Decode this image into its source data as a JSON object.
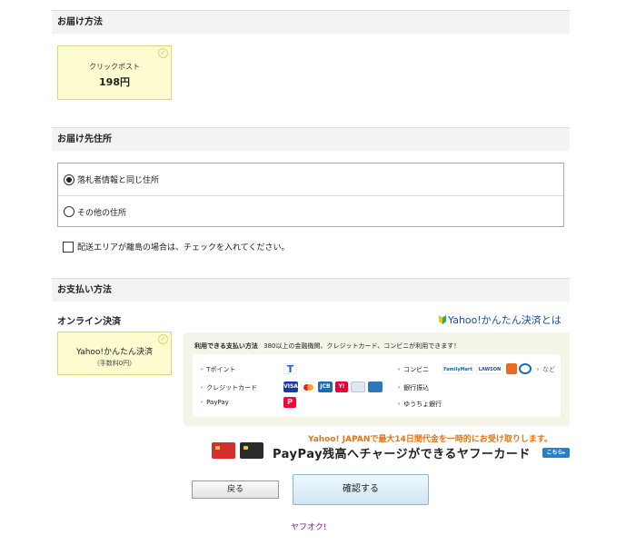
{
  "delivery_method": {
    "heading": "お届け方法",
    "options": [
      {
        "name": "クリックポスト",
        "price": "198円",
        "selected": true
      }
    ]
  },
  "delivery_address": {
    "heading": "お届け先住所",
    "options": [
      {
        "label": "落札者情報と同じ住所",
        "selected": true
      },
      {
        "label": "その他の住所",
        "selected": false
      }
    ],
    "island_checkbox_label": "配送エリアが離島の場合は、チェックを入れてください。",
    "island_checked": false
  },
  "payment": {
    "heading": "お支払い方法",
    "online_label": "オンライン決済",
    "about_link": "Yahoo!かんたん決済とは",
    "option": {
      "name": "Yahoo!かんたん決済",
      "fee": "（手数料0円）",
      "selected": true
    },
    "methods_title": "利用できる支払い方法",
    "methods_note": "380以上の金融機関、クレジットカード、コンビニが利用できます！",
    "methods": {
      "tpoint": "Tポイント",
      "credit": "クレジットカード",
      "paypay": "PayPay",
      "conveni": "コンビニ",
      "bank": "銀行振込",
      "yucho": "ゆうちょ銀行"
    },
    "logos": {
      "tpoint": "T",
      "visa": "VISA",
      "jcb": "JCB",
      "yahoo_card": "Y!",
      "paypay": "P",
      "familymart": "FamilyMart",
      "lawson": "LAWSON",
      "nado": "など"
    }
  },
  "promo": {
    "notice": "Yahoo! JAPANで最大14日間代金を一時的にお受け取りします。",
    "headline": "PayPay残高へチャージができるヤフーカード",
    "link": "こちら▸"
  },
  "buttons": {
    "back": "戻る",
    "confirm": "確認する"
  },
  "footer": {
    "link": "ヤフオク!"
  },
  "colors": {
    "selected_bg": "#fdfbd0",
    "promo_orange": "#e8730f",
    "link_blue": "#1a4da8"
  }
}
